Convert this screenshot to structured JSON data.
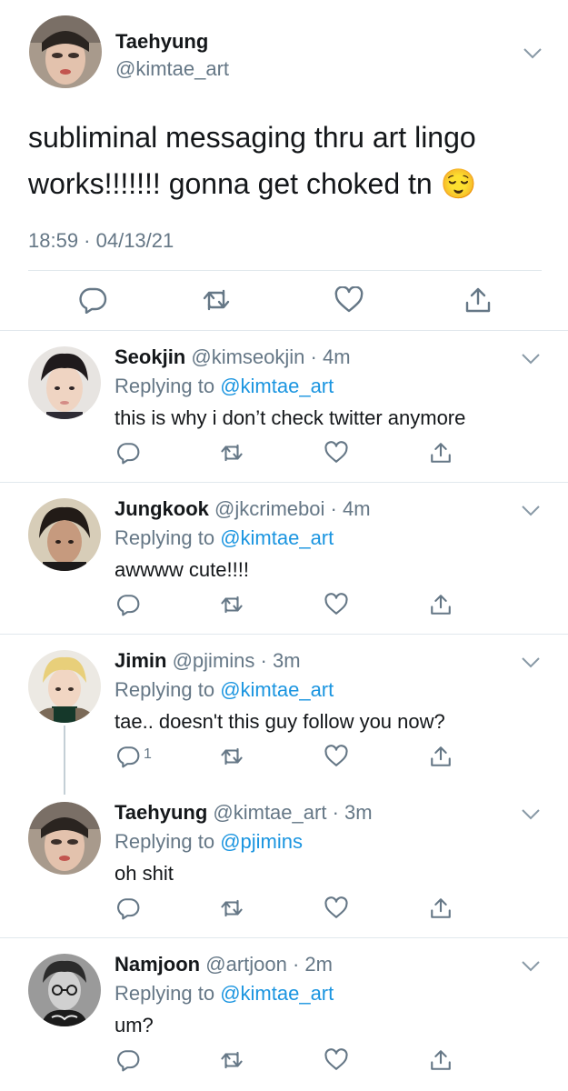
{
  "main_tweet": {
    "name": "Taehyung",
    "handle": "@kimtae_art",
    "text": "subliminal messaging thru art lingo works!!!!!!! gonna get choked tn 😌",
    "timestamp": "18:59 · 04/13/21",
    "actions": [
      "reply-icon",
      "retweet-icon",
      "like-icon",
      "share-icon"
    ]
  },
  "replies": [
    {
      "name": "Seokjin",
      "handle": "@kimseokjin",
      "time": "· 4m",
      "replying_prefix": "Replying to",
      "replying_to": "@kimtae_art",
      "text": "this is why i don’t check twitter anymore",
      "reply_count": ""
    },
    {
      "name": "Jungkook",
      "handle": "@jkcrimeboi",
      "time": "· 4m",
      "replying_prefix": "Replying to",
      "replying_to": "@kimtae_art",
      "text": "awwww cute!!!!",
      "reply_count": ""
    },
    {
      "name": "Jimin",
      "handle": "@pjimins",
      "time": "· 3m",
      "replying_prefix": "Replying to",
      "replying_to": "@kimtae_art",
      "text": "tae.. doesn't this guy follow you now?",
      "reply_count": "1"
    },
    {
      "name": "Taehyung",
      "handle": "@kimtae_art",
      "time": "· 3m",
      "replying_prefix": "Replying to",
      "replying_to": "@pjimins",
      "text": "oh shit",
      "reply_count": ""
    },
    {
      "name": "Namjoon",
      "handle": "@artjoon",
      "time": "· 2m",
      "replying_prefix": "Replying to",
      "replying_to": "@kimtae_art",
      "text": "um?",
      "reply_count": ""
    }
  ],
  "colors": {
    "text": "#14171a",
    "secondary": "#657786",
    "link": "#1b95e0",
    "icon": "#657786",
    "divider": "#e1e8ed"
  }
}
